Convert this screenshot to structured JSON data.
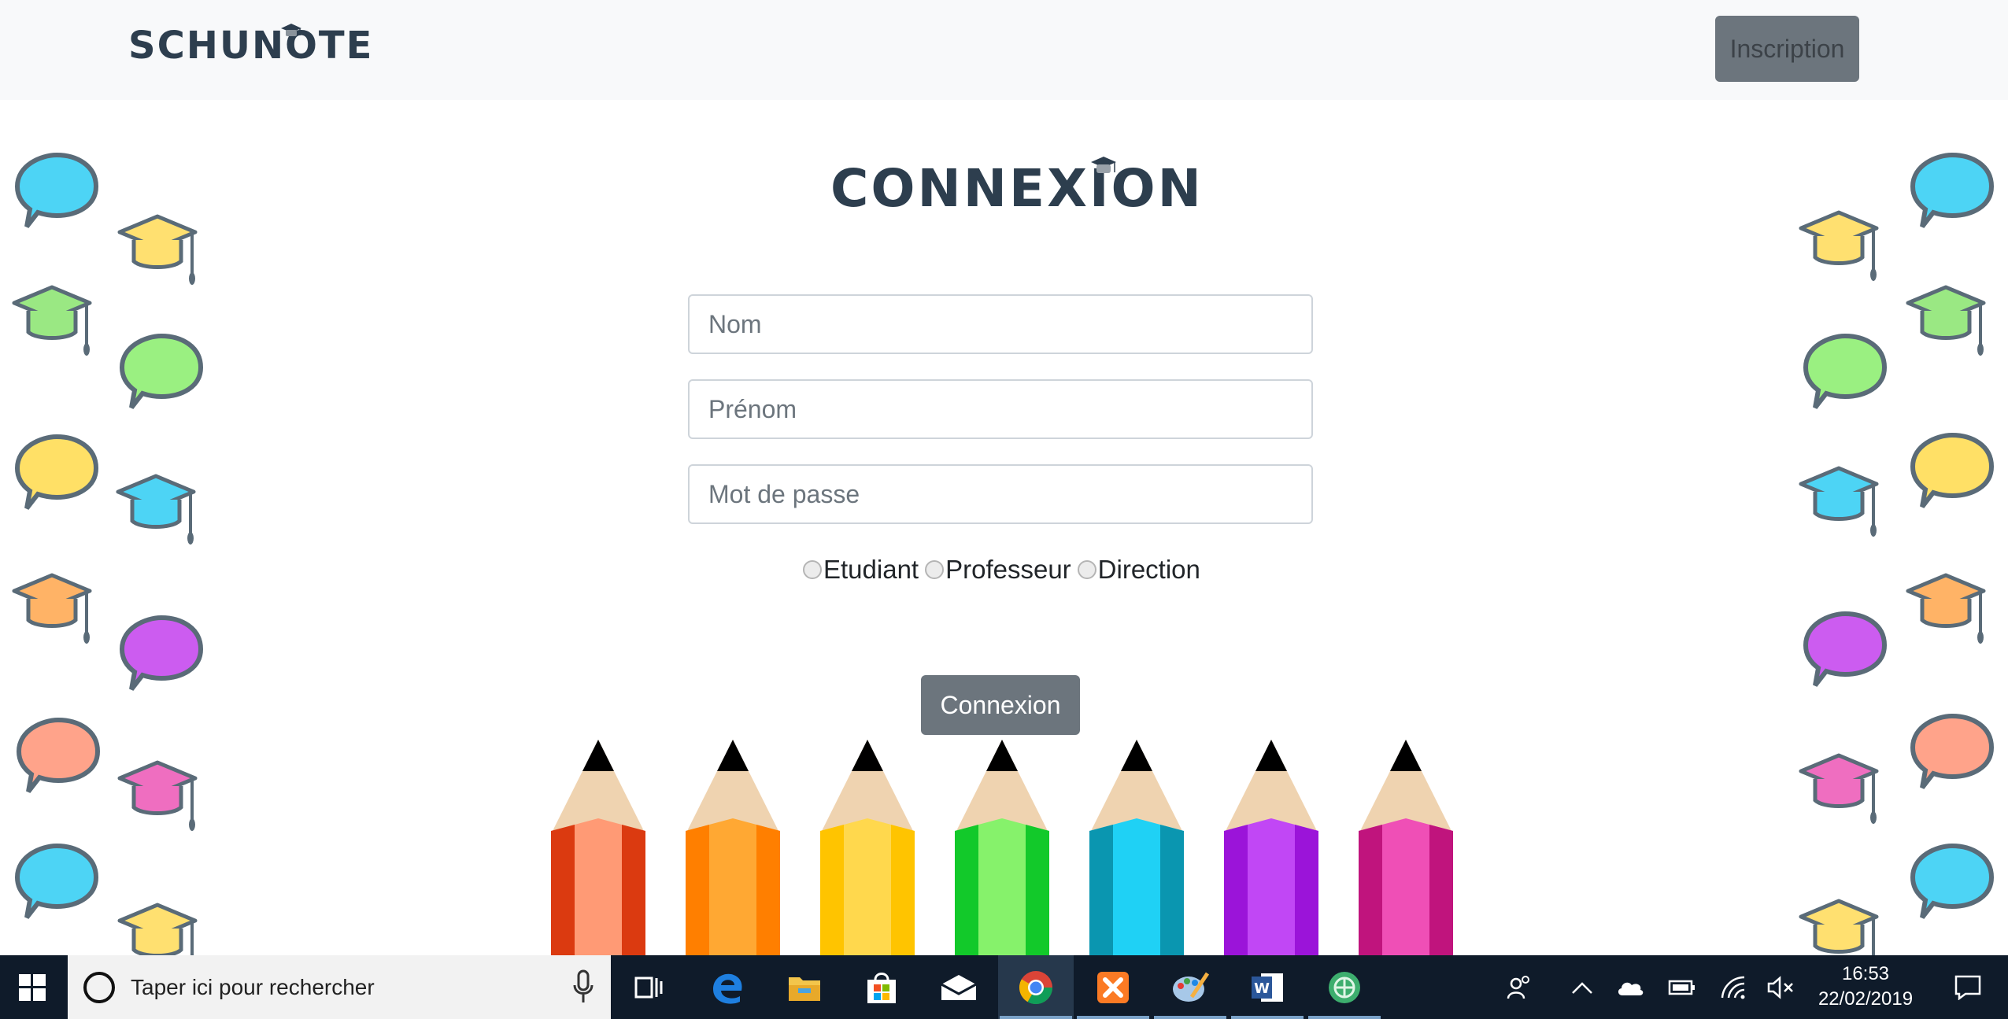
{
  "navbar": {
    "brand": "SCHUNOTE",
    "signup_label": "Inscription"
  },
  "login": {
    "title": "CONNEXION",
    "fields": {
      "nom_placeholder": "Nom",
      "prenom_placeholder": "Prénom",
      "password_placeholder": "Mot de passe"
    },
    "roles": [
      "Etudiant",
      "Professeur",
      "Direction"
    ],
    "submit_label": "Connexion"
  },
  "decor": {
    "pencil_colors": [
      "#ff9a75",
      "#ffa833",
      "#ffd84d",
      "#86f26b",
      "#1fd1f5",
      "#c147f5",
      "#ef4fb6"
    ],
    "bubble_colors": [
      "#4dd4f5",
      "#9af081",
      "#ffe066",
      "#cc5cf0",
      "#ffa38a"
    ],
    "cap_colors": [
      "#ffe070",
      "#9ae883",
      "#4dd4f5",
      "#ffb366",
      "#ef6ec0"
    ]
  },
  "taskbar": {
    "search_placeholder": "Taper ici pour rechercher",
    "time": "16:53",
    "date": "22/02/2019",
    "apps": [
      "task-view-icon",
      "edge-icon",
      "file-explorer-icon",
      "store-icon",
      "mail-icon",
      "chrome-icon",
      "xampp-icon",
      "paint-icon",
      "word-icon",
      "network-app-icon"
    ],
    "tray": [
      "people-icon",
      "chevron-up-icon",
      "onedrive-icon",
      "battery-icon",
      "wifi-icon",
      "volume-muted-icon",
      "notification-icon"
    ]
  }
}
